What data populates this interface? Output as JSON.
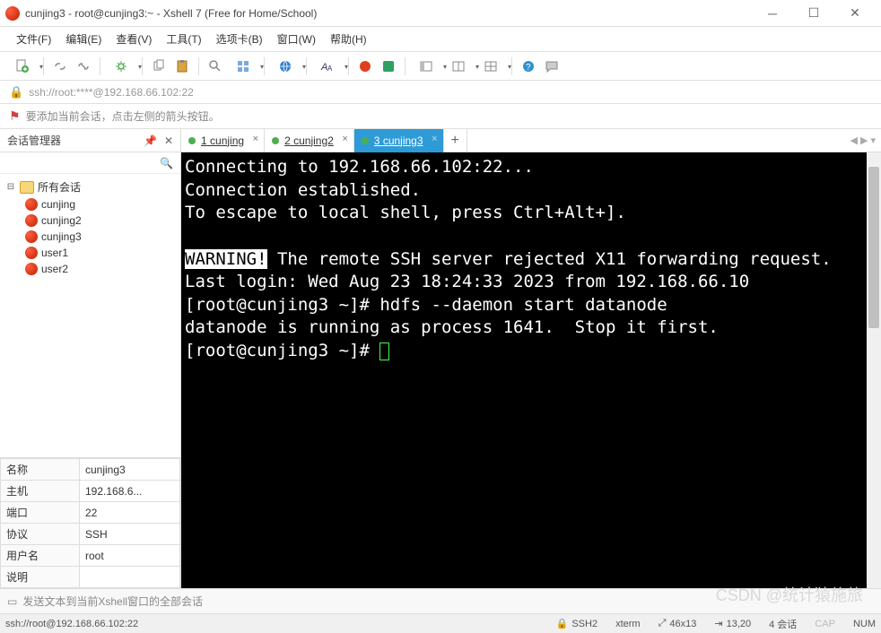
{
  "window": {
    "title": "cunjing3 - root@cunjing3:~ - Xshell 7 (Free for Home/School)"
  },
  "menu": {
    "file": "文件(F)",
    "edit": "编辑(E)",
    "view": "查看(V)",
    "tools": "工具(T)",
    "tabs": "选项卡(B)",
    "window": "窗口(W)",
    "help": "帮助(H)"
  },
  "address": {
    "url": "ssh://root:****@192.168.66.102:22"
  },
  "info": {
    "text": "要添加当前会话，点击左侧的箭头按钮。"
  },
  "sidebar": {
    "title": "会话管理器",
    "root": "所有会话",
    "items": [
      "cunjing",
      "cunjing2",
      "cunjing3",
      "user1",
      "user2"
    ]
  },
  "props": {
    "name_label": "名称",
    "name_value": "cunjing3",
    "host_label": "主机",
    "host_value": "192.168.6...",
    "port_label": "端口",
    "port_value": "22",
    "proto_label": "协议",
    "proto_value": "SSH",
    "user_label": "用户名",
    "user_value": "root",
    "desc_label": "说明",
    "desc_value": ""
  },
  "tabs": {
    "items": [
      {
        "num": "1",
        "label": "cunjing"
      },
      {
        "num": "2",
        "label": "cunjing2"
      },
      {
        "num": "3",
        "label": "cunjing3"
      }
    ],
    "active": 2
  },
  "terminal": {
    "line1": "Connecting to 192.168.66.102:22...",
    "line2": "Connection established.",
    "line3": "To escape to local shell, press Ctrl+Alt+].",
    "warn": "WARNING!",
    "warn_rest": " The remote SSH server rejected X11 forwarding request.",
    "last_login": "Last login: Wed Aug 23 18:24:33 2023 from 192.168.66.10",
    "cmd1": "[root@cunjing3 ~]# hdfs --daemon start datanode",
    "out1": "datanode is running as process 1641.  Stop it first.",
    "prompt": "[root@cunjing3 ~]# "
  },
  "sendbar": {
    "placeholder": "发送文本到当前Xshell窗口的全部会话"
  },
  "status": {
    "conn": "ssh://root@192.168.66.102:22",
    "ssh": "SSH2",
    "term": "xterm",
    "size": "46x13",
    "pos": "13,20",
    "sessions": "4 会话",
    "caps": "CAP",
    "num": "NUM"
  },
  "watermark": "CSDN @统计猿施旅"
}
